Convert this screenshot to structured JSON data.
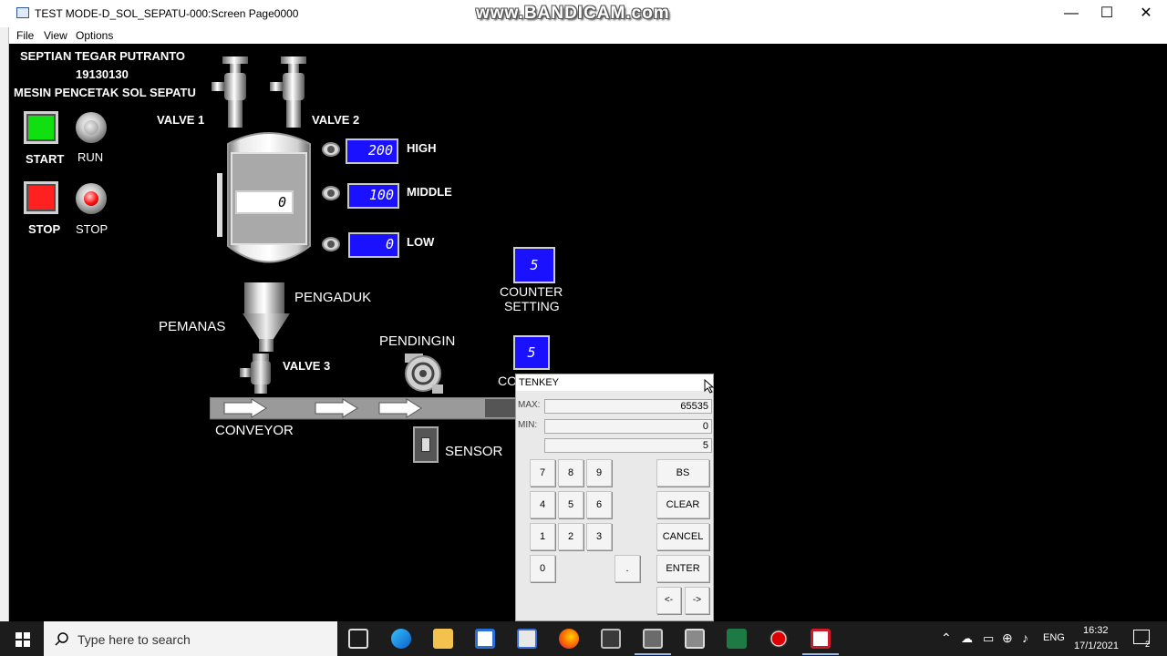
{
  "window": {
    "title": "TEST MODE-D_SOL_SEPATU-000:Screen Page0000",
    "watermark": "www.BANDICAM.com",
    "controls": {
      "minimize": "—",
      "maximize": "☐",
      "close": "✕"
    }
  },
  "menu": [
    "File",
    "View",
    "Options"
  ],
  "hmi": {
    "header": {
      "name": "SEPTIAN TEGAR PUTRANTO",
      "id": "19130130",
      "machine": "MESIN PENCETAK SOL SEPATU"
    },
    "start_button": {
      "label": "START",
      "color": "#10e010"
    },
    "run_lamp": {
      "label": "RUN"
    },
    "stop_button": {
      "label": "STOP",
      "color": "#ff2020"
    },
    "stop_lamp": {
      "label": "STOP",
      "color": "#ff1010"
    },
    "valve1_label": "VALVE 1",
    "valve2_label": "VALVE 2",
    "valve3_label": "VALVE 3",
    "tank_value": "0",
    "levels": {
      "high": {
        "label": "HIGH",
        "value": "200"
      },
      "middle": {
        "label": "MIDDLE",
        "value": "100"
      },
      "low": {
        "label": "LOW",
        "value": "0"
      }
    },
    "mixer_label": "PENGADUK",
    "heater_label": "PEMANAS",
    "cooler_label": "PENDINGIN",
    "conveyor_label": "CONVEYOR",
    "sensor_label": "SENSOR",
    "counter_setting": {
      "value": "5",
      "label_line1": "COUNTER",
      "label_line2": "SETTING"
    },
    "counter": {
      "value": "5",
      "label_partial": "CO"
    }
  },
  "tenkey": {
    "title": "TENKEY",
    "max_label": "MAX:",
    "max_value": "65535",
    "min_label": "MIN:",
    "min_value": "0",
    "input_value": "5",
    "keys": {
      "k7": "7",
      "k8": "8",
      "k9": "9",
      "k4": "4",
      "k5": "5",
      "k6": "6",
      "k1": "1",
      "k2": "2",
      "k3": "3",
      "k0": "0",
      "dot": ".",
      "bs": "BS",
      "clear": "CLEAR",
      "cancel": "CANCEL",
      "enter": "ENTER",
      "left": "<-",
      "right": "->"
    }
  },
  "taskbar": {
    "search_placeholder": "Type here to search",
    "lang": "ENG",
    "time": "16:32",
    "date": "17/1/2021",
    "notification_count": "2"
  }
}
